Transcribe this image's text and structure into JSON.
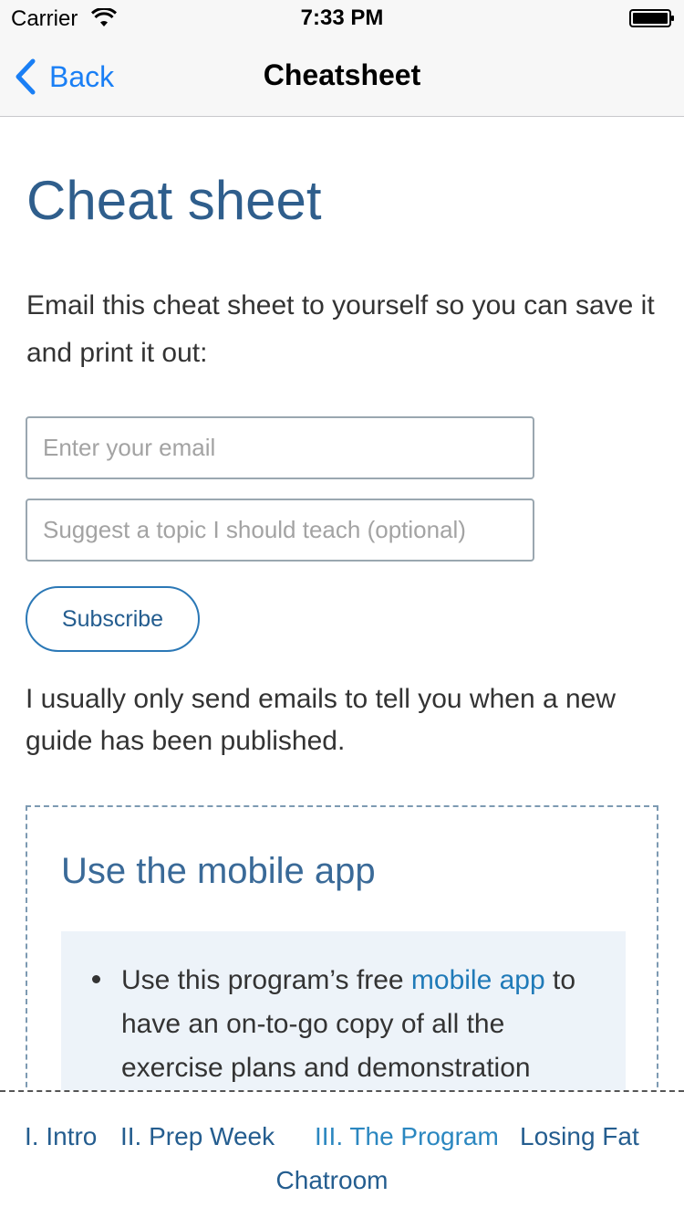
{
  "status_bar": {
    "carrier": "Carrier",
    "time": "7:33 PM",
    "icons": [
      "wifi-icon",
      "battery-icon"
    ]
  },
  "nav_bar": {
    "back_label": "Back",
    "title": "Cheatsheet",
    "accent_color": "#1a7ff5"
  },
  "content": {
    "title": "Cheat sheet",
    "intro": "Email this cheat sheet to yourself so you can save it and print it out:",
    "email_placeholder": "Enter your email",
    "topic_placeholder": "Suggest a topic I should teach (optional)",
    "subscribe_label": "Subscribe",
    "note": "I usually only send emails to tell you when a new guide has been published.",
    "app_box": {
      "heading": "Use the mobile app",
      "bullet_prefix": "Use this program’s free ",
      "bullet_link": "mobile app",
      "bullet_suffix": " to have an on-to-go copy of all the exercise plans and demonstration"
    }
  },
  "bottom_nav": {
    "items": [
      {
        "label": "I. Intro"
      },
      {
        "label": "II. Prep Week"
      },
      {
        "label": "III. The Program"
      },
      {
        "label": "Losing Fat"
      },
      {
        "label": "Chatroom"
      }
    ],
    "active_index": 2
  },
  "colors": {
    "heading_blue": "#2f5e8c",
    "link_blue": "#1f7ab8",
    "panel_bg": "#edf3f9"
  }
}
